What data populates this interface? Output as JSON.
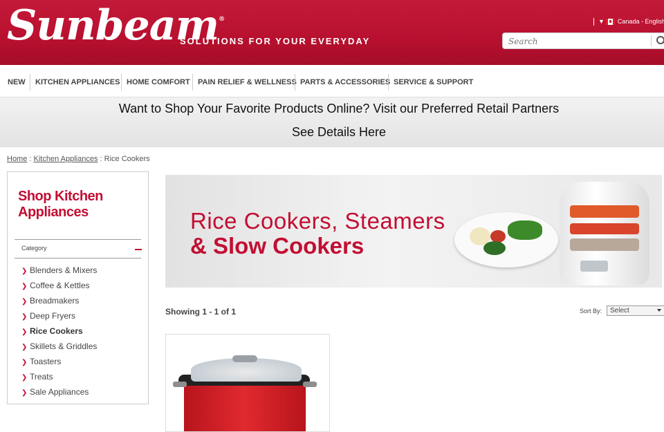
{
  "header": {
    "logo_text": "Sunbeam",
    "logo_mark": "®",
    "tagline": "SOLUTIONS FOR YOUR EVERYDAY",
    "locale": "Canada - English",
    "search_placeholder": "Search",
    "brand_color": "#c41a3a"
  },
  "nav": {
    "items": [
      "NEW",
      "KITCHEN APPLIANCES",
      "HOME COMFORT",
      "PAIN RELIEF & WELLNESS",
      "PARTS & ACCESSORIES",
      "SERVICE & SUPPORT"
    ]
  },
  "promo": {
    "line1": "Want to Shop Your Favorite Products Online? Visit our Preferred Retail Partners",
    "line2": "See Details Here"
  },
  "breadcrumb": {
    "home": "Home",
    "sep1": " : ",
    "category": "Kitchen Appliances",
    "sep2": " : ",
    "current": "Rice Cookers"
  },
  "sidebar": {
    "title": "Shop Kitchen Appliances",
    "category_label": "Category",
    "items": [
      {
        "label": "Blenders & Mixers",
        "active": false
      },
      {
        "label": "Coffee & Kettles",
        "active": false
      },
      {
        "label": "Breadmakers",
        "active": false
      },
      {
        "label": "Deep Fryers",
        "active": false
      },
      {
        "label": "Rice Cookers",
        "active": true
      },
      {
        "label": "Skillets & Griddles",
        "active": false
      },
      {
        "label": "Toasters",
        "active": false
      },
      {
        "label": "Treats",
        "active": false
      },
      {
        "label": "Sale Appliances",
        "active": false
      }
    ]
  },
  "banner": {
    "line1": "Rice Cookers, Steamers",
    "line2": "& Slow Cookers"
  },
  "results": {
    "showing": "Showing 1 - 1 of 1",
    "sort_label": "Sort By:",
    "sort_value": "Select"
  },
  "icons": {
    "search": "search-icon",
    "flag": "canada-flag-icon",
    "chevron": "chevron-right-icon",
    "collapse": "minus-icon"
  }
}
